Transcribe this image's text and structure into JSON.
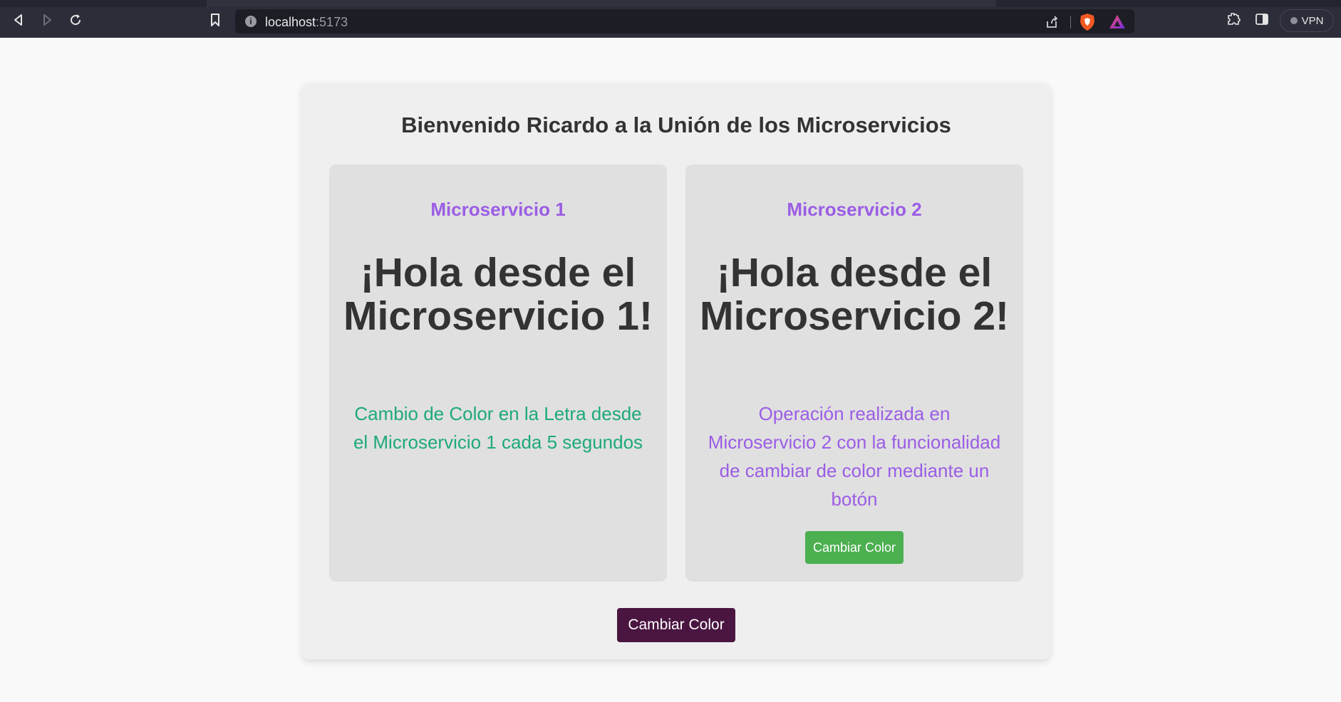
{
  "browser": {
    "url_host": "localhost",
    "url_port": ":5173",
    "vpn_label": "VPN"
  },
  "page": {
    "title": "Bienvenido Ricardo a la Unión de los Microservicios",
    "main_button_label": "Cambiar Color"
  },
  "microservices": [
    {
      "label": "Microservicio 1",
      "greeting": "¡Hola desde el Microservicio 1!",
      "description": "Cambio de Color en la Letra desde el Microservicio 1 cada 5 segundos"
    },
    {
      "label": "Microservicio 2",
      "greeting": "¡Hola desde el Microservicio 2!",
      "description": "Operación realizada en Microservicio 2 con la funcionalidad de cambiar de color mediante un botón",
      "button_label": "Cambiar Color"
    }
  ],
  "colors": {
    "accent_purple": "#9b5de5",
    "text_green": "#1ea97c",
    "button_green": "#4caf50",
    "button_main": "#4a1541"
  }
}
